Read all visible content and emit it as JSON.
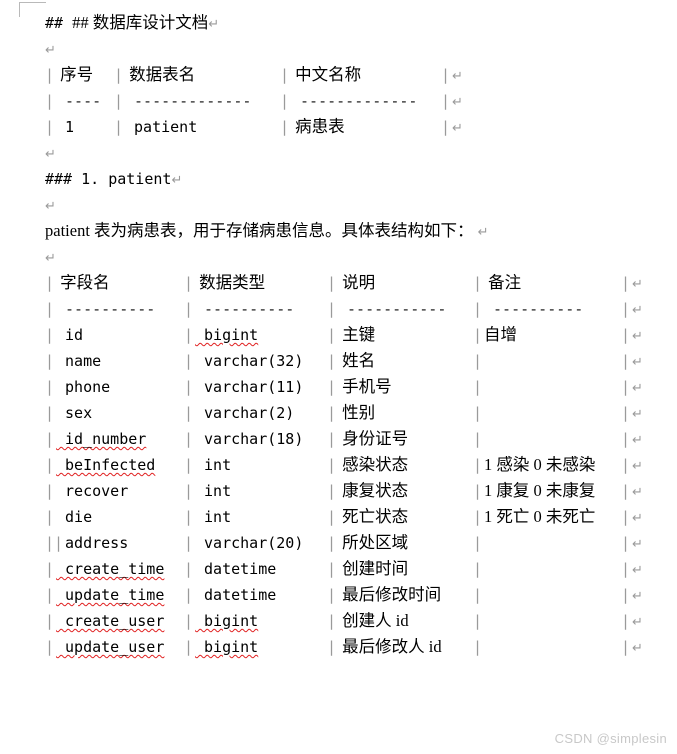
{
  "document": {
    "heading_h2": "## 数据库设计文档",
    "heading_h3": "### 1. patient",
    "paragraph": "patient 表为病患表，用于存储病患信息。具体表结构如下：",
    "return_mark": "↵",
    "pipe": "|",
    "double_pipe": "||"
  },
  "table_index": {
    "headers": [
      "序号",
      "数据表名",
      "中文名称"
    ],
    "separators": [
      "----",
      "-------------",
      "-------------"
    ],
    "rows": [
      [
        "1",
        "patient",
        "病患表"
      ]
    ]
  },
  "table_patient": {
    "headers": [
      "字段名",
      "数据类型",
      "说明",
      "备注"
    ],
    "separators": [
      "----------",
      "----------",
      "-----------",
      "----------"
    ],
    "rows": [
      {
        "field": "id",
        "type": "bigint",
        "desc": "主键",
        "note": "自增",
        "field_spell": false,
        "type_spell": true,
        "lead": "|"
      },
      {
        "field": "name",
        "type": "varchar(32)",
        "desc": "姓名",
        "note": "",
        "field_spell": false,
        "type_spell": false,
        "lead": "|"
      },
      {
        "field": "phone",
        "type": "varchar(11)",
        "desc": "手机号",
        "note": "",
        "field_spell": false,
        "type_spell": false,
        "lead": "|"
      },
      {
        "field": "sex",
        "type": "varchar(2)",
        "desc": "性别",
        "note": "",
        "field_spell": false,
        "type_spell": false,
        "lead": "|"
      },
      {
        "field": "id_number",
        "type": "varchar(18)",
        "desc": "身份证号",
        "note": "",
        "field_spell": true,
        "type_spell": false,
        "lead": "|"
      },
      {
        "field": "beInfected",
        "type": "int",
        "desc": "感染状态",
        "note": "1 感染 0 未感染",
        "field_spell": true,
        "type_spell": false,
        "lead": "|"
      },
      {
        "field": "recover",
        "type": "int",
        "desc": "康复状态",
        "note": "1 康复 0 未康复",
        "field_spell": false,
        "type_spell": false,
        "lead": "|"
      },
      {
        "field": "die",
        "type": "int",
        "desc": "死亡状态",
        "note": "1 死亡 0 未死亡",
        "field_spell": false,
        "type_spell": false,
        "lead": "|"
      },
      {
        "field": "address",
        "type": "varchar(20)",
        "desc": "所处区域",
        "note": "",
        "field_spell": false,
        "type_spell": false,
        "lead": "||"
      },
      {
        "field": "create_time",
        "type": "datetime",
        "desc": "创建时间",
        "note": "",
        "field_spell": true,
        "type_spell": false,
        "lead": "|"
      },
      {
        "field": "update_time",
        "type": "datetime",
        "desc": "最后修改时间",
        "note": "",
        "field_spell": true,
        "type_spell": false,
        "lead": "|"
      },
      {
        "field": "create_user",
        "type": "bigint",
        "desc": "创建人 id",
        "note": "",
        "field_spell": true,
        "type_spell": true,
        "lead": "|"
      },
      {
        "field": "update_user",
        "type": "bigint",
        "desc": "最后修改人 id",
        "note": "",
        "field_spell": true,
        "type_spell": true,
        "lead": "|"
      }
    ]
  },
  "watermark": {
    "text": "CSDN @simplesin"
  }
}
